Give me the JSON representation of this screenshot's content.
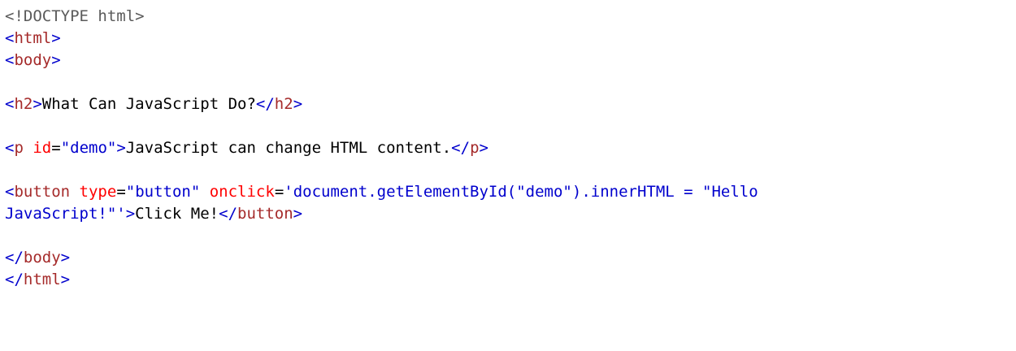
{
  "colors": {
    "background": "#ffffff",
    "doctype": "#5a5a5a",
    "bracket": "#0000cd",
    "tag": "#a52a2a",
    "attribute": "#ff0000",
    "value": "#0000cd",
    "text": "#000000"
  },
  "code": {
    "lines": [
      [
        {
          "t": "doctype",
          "v": "<!DOCTYPE html>"
        }
      ],
      [
        {
          "t": "bracket",
          "v": "<"
        },
        {
          "t": "tag",
          "v": "html"
        },
        {
          "t": "bracket",
          "v": ">"
        }
      ],
      [
        {
          "t": "bracket",
          "v": "<"
        },
        {
          "t": "tag",
          "v": "body"
        },
        {
          "t": "bracket",
          "v": ">"
        }
      ],
      [],
      [
        {
          "t": "bracket",
          "v": "<"
        },
        {
          "t": "tag",
          "v": "h2"
        },
        {
          "t": "bracket",
          "v": ">"
        },
        {
          "t": "plain",
          "v": "What Can JavaScript Do?"
        },
        {
          "t": "bracket",
          "v": "</"
        },
        {
          "t": "tag",
          "v": "h2"
        },
        {
          "t": "bracket",
          "v": ">"
        }
      ],
      [],
      [
        {
          "t": "bracket",
          "v": "<"
        },
        {
          "t": "tag",
          "v": "p"
        },
        {
          "t": "plain",
          "v": " "
        },
        {
          "t": "attr",
          "v": "id"
        },
        {
          "t": "plain",
          "v": "="
        },
        {
          "t": "value",
          "v": "\"demo\""
        },
        {
          "t": "bracket",
          "v": ">"
        },
        {
          "t": "plain",
          "v": "JavaScript can change HTML content."
        },
        {
          "t": "bracket",
          "v": "</"
        },
        {
          "t": "tag",
          "v": "p"
        },
        {
          "t": "bracket",
          "v": ">"
        }
      ],
      [],
      [
        {
          "t": "bracket",
          "v": "<"
        },
        {
          "t": "tag",
          "v": "button"
        },
        {
          "t": "plain",
          "v": " "
        },
        {
          "t": "attr",
          "v": "type"
        },
        {
          "t": "plain",
          "v": "="
        },
        {
          "t": "value",
          "v": "\"button\""
        },
        {
          "t": "plain",
          "v": " "
        },
        {
          "t": "attr",
          "v": "onclick"
        },
        {
          "t": "plain",
          "v": "="
        },
        {
          "t": "value",
          "v": "'document.getElementById(\"demo\").innerHTML = \"Hello"
        }
      ],
      [
        {
          "t": "value",
          "v": "JavaScript!\"'"
        },
        {
          "t": "bracket",
          "v": ">"
        },
        {
          "t": "plain",
          "v": "Click Me!"
        },
        {
          "t": "bracket",
          "v": "</"
        },
        {
          "t": "tag",
          "v": "button"
        },
        {
          "t": "bracket",
          "v": ">"
        }
      ],
      [],
      [
        {
          "t": "bracket",
          "v": "</"
        },
        {
          "t": "tag",
          "v": "body"
        },
        {
          "t": "bracket",
          "v": ">"
        }
      ],
      [
        {
          "t": "bracket",
          "v": "</"
        },
        {
          "t": "tag",
          "v": "html"
        },
        {
          "t": "bracket",
          "v": ">"
        }
      ]
    ]
  }
}
